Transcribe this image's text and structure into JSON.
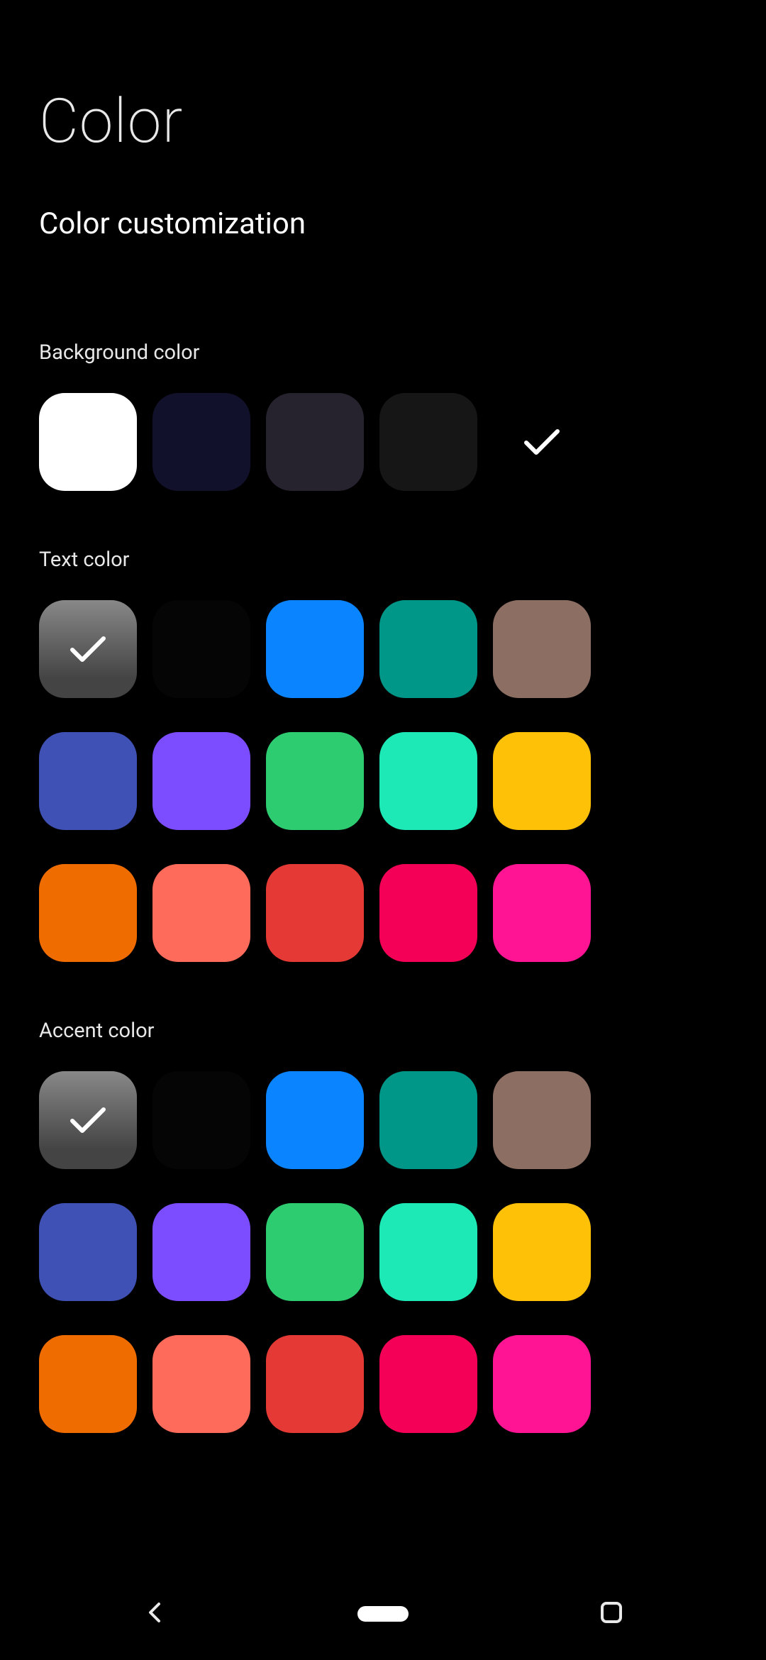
{
  "page": {
    "title": "Color",
    "subtitle": "Color customization"
  },
  "sections": {
    "background": {
      "label": "Background color",
      "swatches": [
        {
          "color": "#ffffff",
          "selected": false
        },
        {
          "color": "#11112b",
          "selected": false
        },
        {
          "color": "#26232f",
          "selected": false
        },
        {
          "color": "#161616",
          "selected": false
        },
        {
          "color": "#000000",
          "selected": true
        }
      ]
    },
    "text": {
      "label": "Text color",
      "swatches": [
        {
          "color": "gradient",
          "selected": true
        },
        {
          "color": "#050505",
          "selected": false
        },
        {
          "color": "#0b84ff",
          "selected": false
        },
        {
          "color": "#009688",
          "selected": false
        },
        {
          "color": "#8d6e63",
          "selected": false
        },
        {
          "color": "#3f51b5",
          "selected": false
        },
        {
          "color": "#7c4dff",
          "selected": false
        },
        {
          "color": "#2ecc71",
          "selected": false
        },
        {
          "color": "#1de9b6",
          "selected": false
        },
        {
          "color": "#ffc107",
          "selected": false
        },
        {
          "color": "#ef6c00",
          "selected": false
        },
        {
          "color": "#ff6b5b",
          "selected": false
        },
        {
          "color": "#e53935",
          "selected": false
        },
        {
          "color": "#f50057",
          "selected": false
        },
        {
          "color": "#ff1493",
          "selected": false
        }
      ]
    },
    "accent": {
      "label": "Accent color",
      "swatches": [
        {
          "color": "gradient",
          "selected": true
        },
        {
          "color": "#050505",
          "selected": false
        },
        {
          "color": "#0b84ff",
          "selected": false
        },
        {
          "color": "#009688",
          "selected": false
        },
        {
          "color": "#8d6e63",
          "selected": false
        },
        {
          "color": "#3f51b5",
          "selected": false
        },
        {
          "color": "#7c4dff",
          "selected": false
        },
        {
          "color": "#2ecc71",
          "selected": false
        },
        {
          "color": "#1de9b6",
          "selected": false
        },
        {
          "color": "#ffc107",
          "selected": false
        },
        {
          "color": "#ef6c00",
          "selected": false
        },
        {
          "color": "#ff6b5b",
          "selected": false
        },
        {
          "color": "#e53935",
          "selected": false
        },
        {
          "color": "#f50057",
          "selected": false
        },
        {
          "color": "#ff1493",
          "selected": false
        }
      ]
    }
  }
}
